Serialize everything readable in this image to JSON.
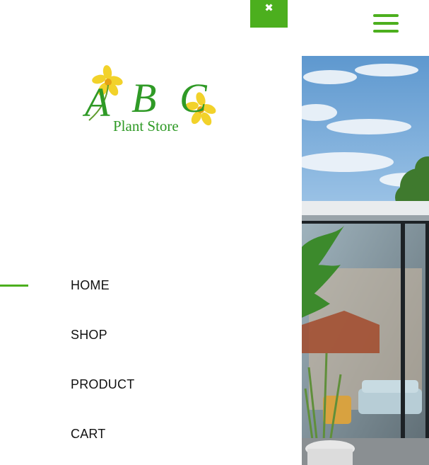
{
  "theme": {
    "accent": "#4caf1e",
    "text": "#111111",
    "background": "#ffffff"
  },
  "close_button": {
    "glyph": "✖",
    "icon": "close-icon"
  },
  "hamburger": {
    "icon": "hamburger-menu-icon"
  },
  "logo": {
    "letters": [
      "A",
      "B",
      "C"
    ],
    "tagline": "Plant Store"
  },
  "nav": {
    "active_index": 0,
    "items": [
      {
        "label": "HOME"
      },
      {
        "label": "SHOP"
      },
      {
        "label": "PRODUCT"
      },
      {
        "label": "CART"
      }
    ]
  }
}
